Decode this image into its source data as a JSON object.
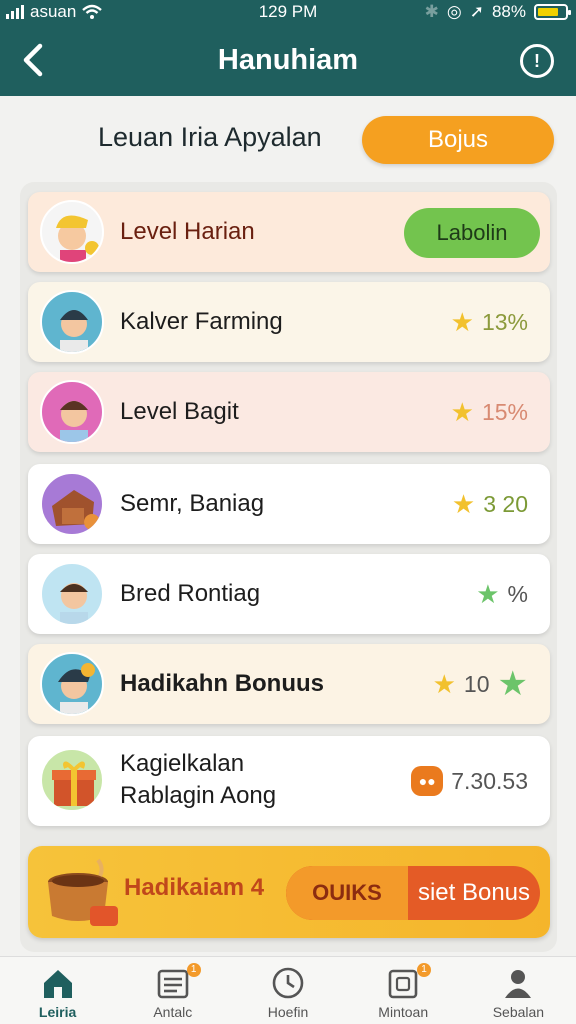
{
  "status_bar": {
    "carrier": "asuan",
    "time": "129 PM",
    "battery": "88%"
  },
  "header": {
    "title": "Hanuhiam"
  },
  "subheader": {
    "title": "Leuan Iria Apyalan",
    "bonus_button": "Bojus"
  },
  "rows": [
    {
      "label": "Level Harian",
      "action": "Labolin"
    },
    {
      "label": "Kalver Farming",
      "value": "13%"
    },
    {
      "label": "Level Bagit",
      "value": "15%"
    },
    {
      "label": "Semr, Baniag",
      "value": "3 20"
    },
    {
      "label": "Bred Rontiag",
      "value": "%"
    },
    {
      "label": "Hadikahn Bonuus",
      "value": "10"
    },
    {
      "label_line1": "Kagielkalan",
      "label_line2": "Rablagin Aong",
      "value": "7.30.53"
    }
  ],
  "promo": {
    "text": "Hadikaiam",
    "mid": "4",
    "button_left": "OUIKS",
    "button_right": "siet Bonus"
  },
  "bottom_nav": [
    {
      "label": "Leiria",
      "icon": "home-icon"
    },
    {
      "label": "Antalc",
      "icon": "list-icon",
      "badge": "1"
    },
    {
      "label": "Hoefin",
      "icon": "clock-icon"
    },
    {
      "label": "Mintoan",
      "icon": "wallet-icon",
      "badge": "1"
    },
    {
      "label": "Sebalan",
      "icon": "profile-icon"
    }
  ],
  "colors": {
    "header": "#1f5f5e",
    "accent_orange": "#f5a020",
    "green": "#73c44e"
  }
}
